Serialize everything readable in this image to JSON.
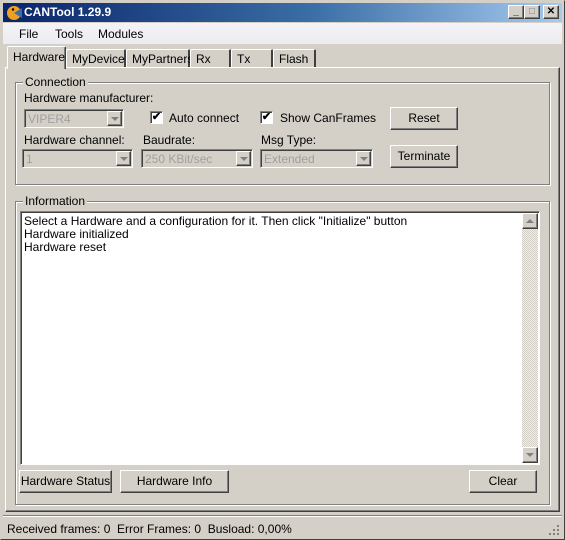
{
  "window": {
    "title": "CANTool 1.29.9",
    "controls": {
      "minimize": "_",
      "maximize": "□",
      "close": "✕"
    }
  },
  "menubar": {
    "items": [
      "File",
      "Tools",
      "Modules"
    ]
  },
  "tabs": [
    "Hardware",
    "MyDevice",
    "MyPartners",
    "Rx",
    "Tx",
    "Flash"
  ],
  "active_tab": "Hardware",
  "connection": {
    "title": "Connection",
    "hardware_manufacturer_label": "Hardware manufacturer:",
    "hardware_manufacturer_value": "VIPER4",
    "auto_connect_label": "Auto connect",
    "auto_connect_checked": true,
    "show_canframes_label": "Show CanFrames",
    "show_canframes_checked": true,
    "reset_label": "Reset",
    "hardware_channel_label": "Hardware channel:",
    "hardware_channel_value": "1",
    "baudrate_label": "Baudrate:",
    "baudrate_value": "250 KBit/sec",
    "msg_type_label": "Msg Type:",
    "msg_type_value": "Extended",
    "terminate_label": "Terminate"
  },
  "information": {
    "title": "Information",
    "lines": [
      "Select a Hardware and a configuration for it. Then click \"Initialize\" button",
      "Hardware initialized",
      "Hardware reset"
    ],
    "hardware_status_label": "Hardware Status",
    "hardware_info_label": "Hardware Info",
    "clear_label": "Clear"
  },
  "statusbar": {
    "text": "Received frames: 0  Error Frames: 0  Busload: 0,00%"
  },
  "colors": {
    "titlebar_start": "#0a246a",
    "titlebar_end": "#a6caf0",
    "face": "#d4d0c8"
  }
}
